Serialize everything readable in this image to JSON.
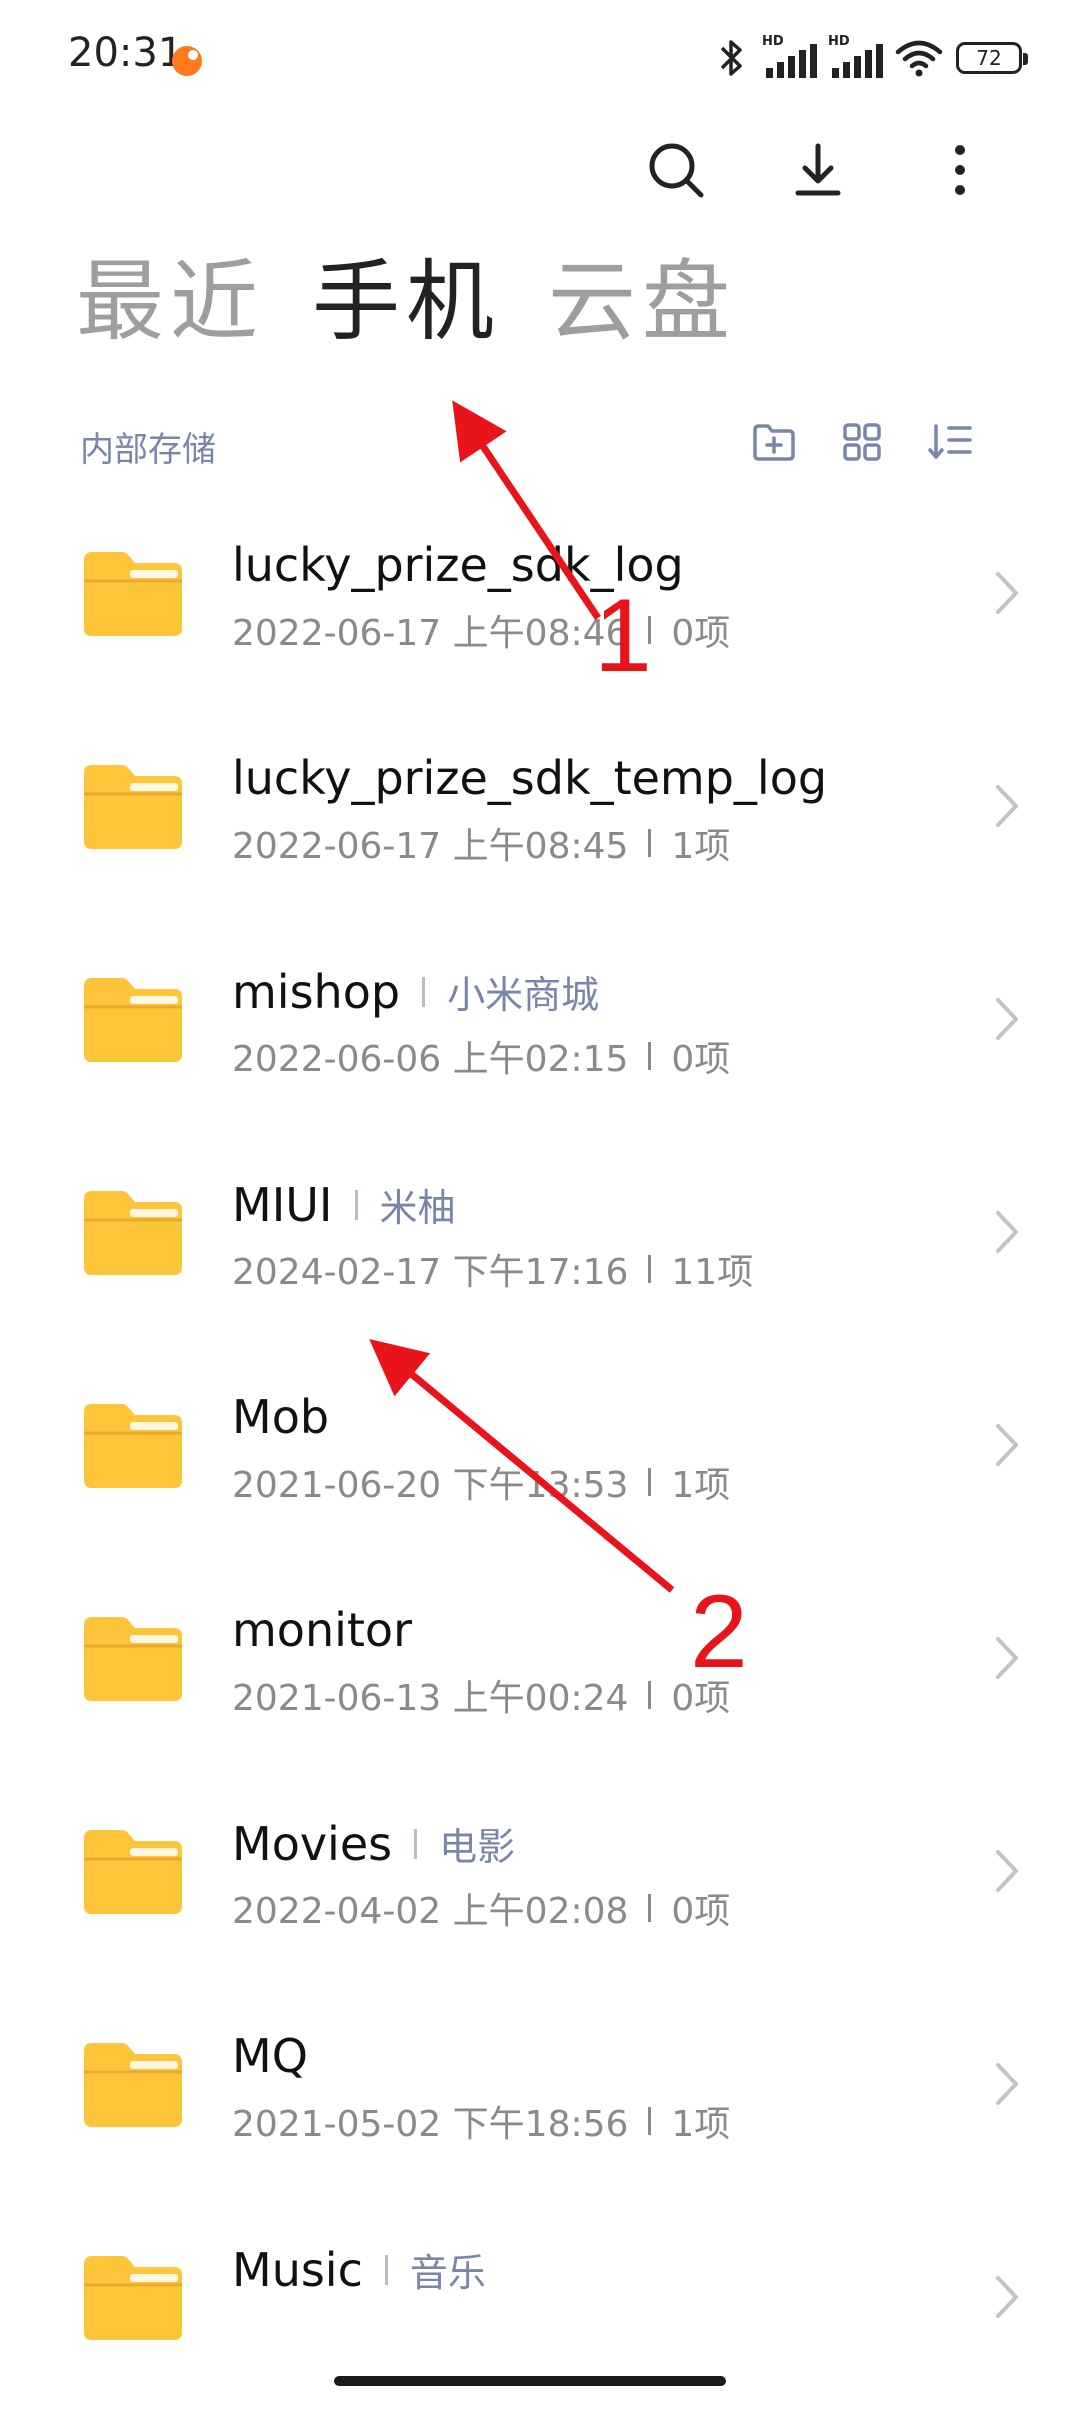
{
  "status_bar": {
    "time": "20:31",
    "hd_label": "HD",
    "battery": "72"
  },
  "toolbar": {
    "search_icon": "search-icon",
    "download_icon": "download-icon",
    "more_icon": "more-vertical-icon"
  },
  "tabs": [
    {
      "label": "最近",
      "active": false
    },
    {
      "label": "手机",
      "active": true
    },
    {
      "label": "云盘",
      "active": false
    }
  ],
  "path": {
    "label": "内部存储",
    "new_folder_icon": "new-folder-icon",
    "grid_view_icon": "grid-view-icon",
    "sort_icon": "sort-icon"
  },
  "files": [
    {
      "name": "lucky_prize_sdk_log",
      "alias": "",
      "date": "2022-06-17 上午08:46",
      "count": "0项"
    },
    {
      "name": "lucky_prize_sdk_temp_log",
      "alias": "",
      "date": "2022-06-17 上午08:45",
      "count": "1项"
    },
    {
      "name": "mishop",
      "alias": "小米商城",
      "date": "2022-06-06 上午02:15",
      "count": "0项"
    },
    {
      "name": "MIUI",
      "alias": "米柚",
      "date": "2024-02-17 下午17:16",
      "count": "11项"
    },
    {
      "name": "Mob",
      "alias": "",
      "date": "2021-06-20 下午13:53",
      "count": "1项"
    },
    {
      "name": "monitor",
      "alias": "",
      "date": "2021-06-13 上午00:24",
      "count": "0项"
    },
    {
      "name": "Movies",
      "alias": "电影",
      "date": "2022-04-02 上午02:08",
      "count": "0项"
    },
    {
      "name": "MQ",
      "alias": "",
      "date": "2021-05-02 下午18:56",
      "count": "1项"
    },
    {
      "name": "Music",
      "alias": "音乐",
      "date": "",
      "count": ""
    }
  ],
  "annotations": {
    "one": "1",
    "two": "2",
    "color": "#e8141a"
  },
  "colors": {
    "folder": "#ffc53a",
    "folder_tab": "#ffd87a",
    "alias_text": "#7a86a8",
    "meta_text": "#8a8a8a"
  }
}
